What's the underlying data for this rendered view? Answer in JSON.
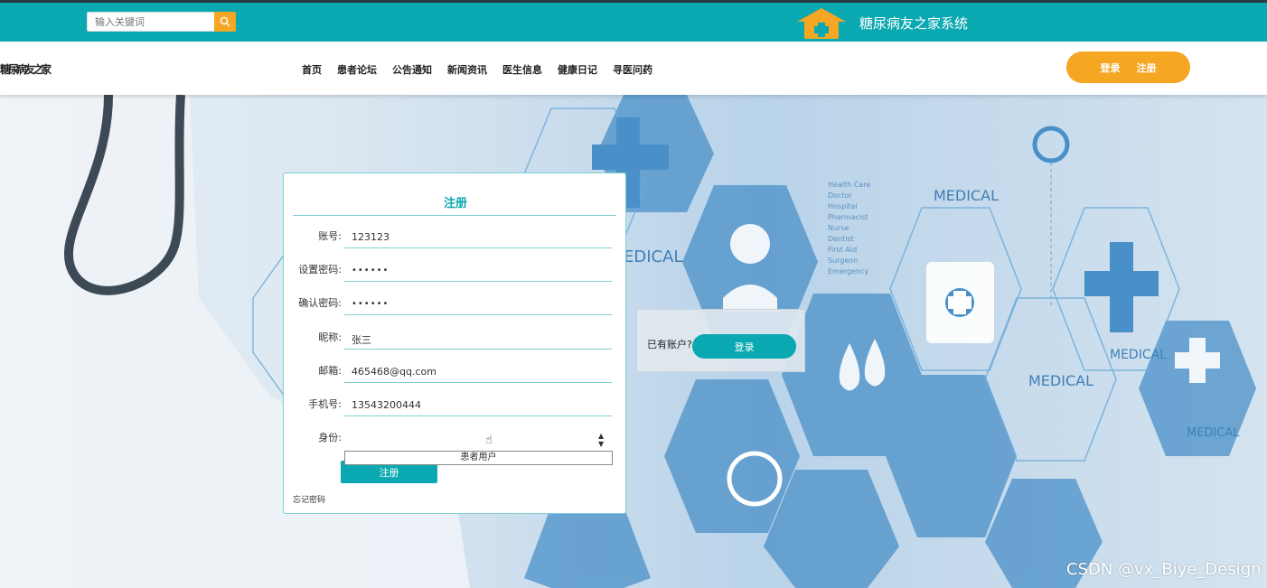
{
  "header": {
    "search": {
      "placeholder": "输入关键词",
      "icon": "search-icon"
    },
    "site_title": "糖尿病友之家系统",
    "logo_icon": "house-plus-icon",
    "accent": "#0aa8b0",
    "orange": "#f5a623"
  },
  "nav": {
    "brand": "糖尿病友之家",
    "items": [
      "首页",
      "患者论坛",
      "公告通知",
      "新闻资讯",
      "医生信息",
      "健康日记",
      "寻医问药"
    ],
    "login_label": "登录",
    "register_label": "注册"
  },
  "register": {
    "title": "注册",
    "fields": [
      {
        "label": "账号:",
        "value": "123123"
      },
      {
        "label": "设置密码:",
        "value": "••••••"
      },
      {
        "label": "确认密码:",
        "value": "••••••"
      },
      {
        "label": "昵称:",
        "value": "张三"
      },
      {
        "label": "邮箱:",
        "value": "465468@qq.com"
      },
      {
        "label": "手机号:",
        "value": "13543200444"
      },
      {
        "label": "身份:",
        "value": ""
      }
    ],
    "role_option": "患者用户",
    "submit_label": "注册",
    "forgot_label": "忘记密码"
  },
  "login_prompt": {
    "question": "已有账户?",
    "button_label": "登录"
  },
  "background": {
    "labels": [
      "MEDICAL",
      "MEDICAL",
      "MEDICAL",
      "MEDICAL",
      "EDICAL"
    ],
    "word_list": [
      "Health Care",
      "Doctor",
      "Hospital",
      "Pharmacist",
      "Nurse",
      "Dentist",
      "First Aid",
      "Surgeon",
      "Emergency"
    ]
  },
  "watermark": "CSDN @vx_Biye_Design"
}
